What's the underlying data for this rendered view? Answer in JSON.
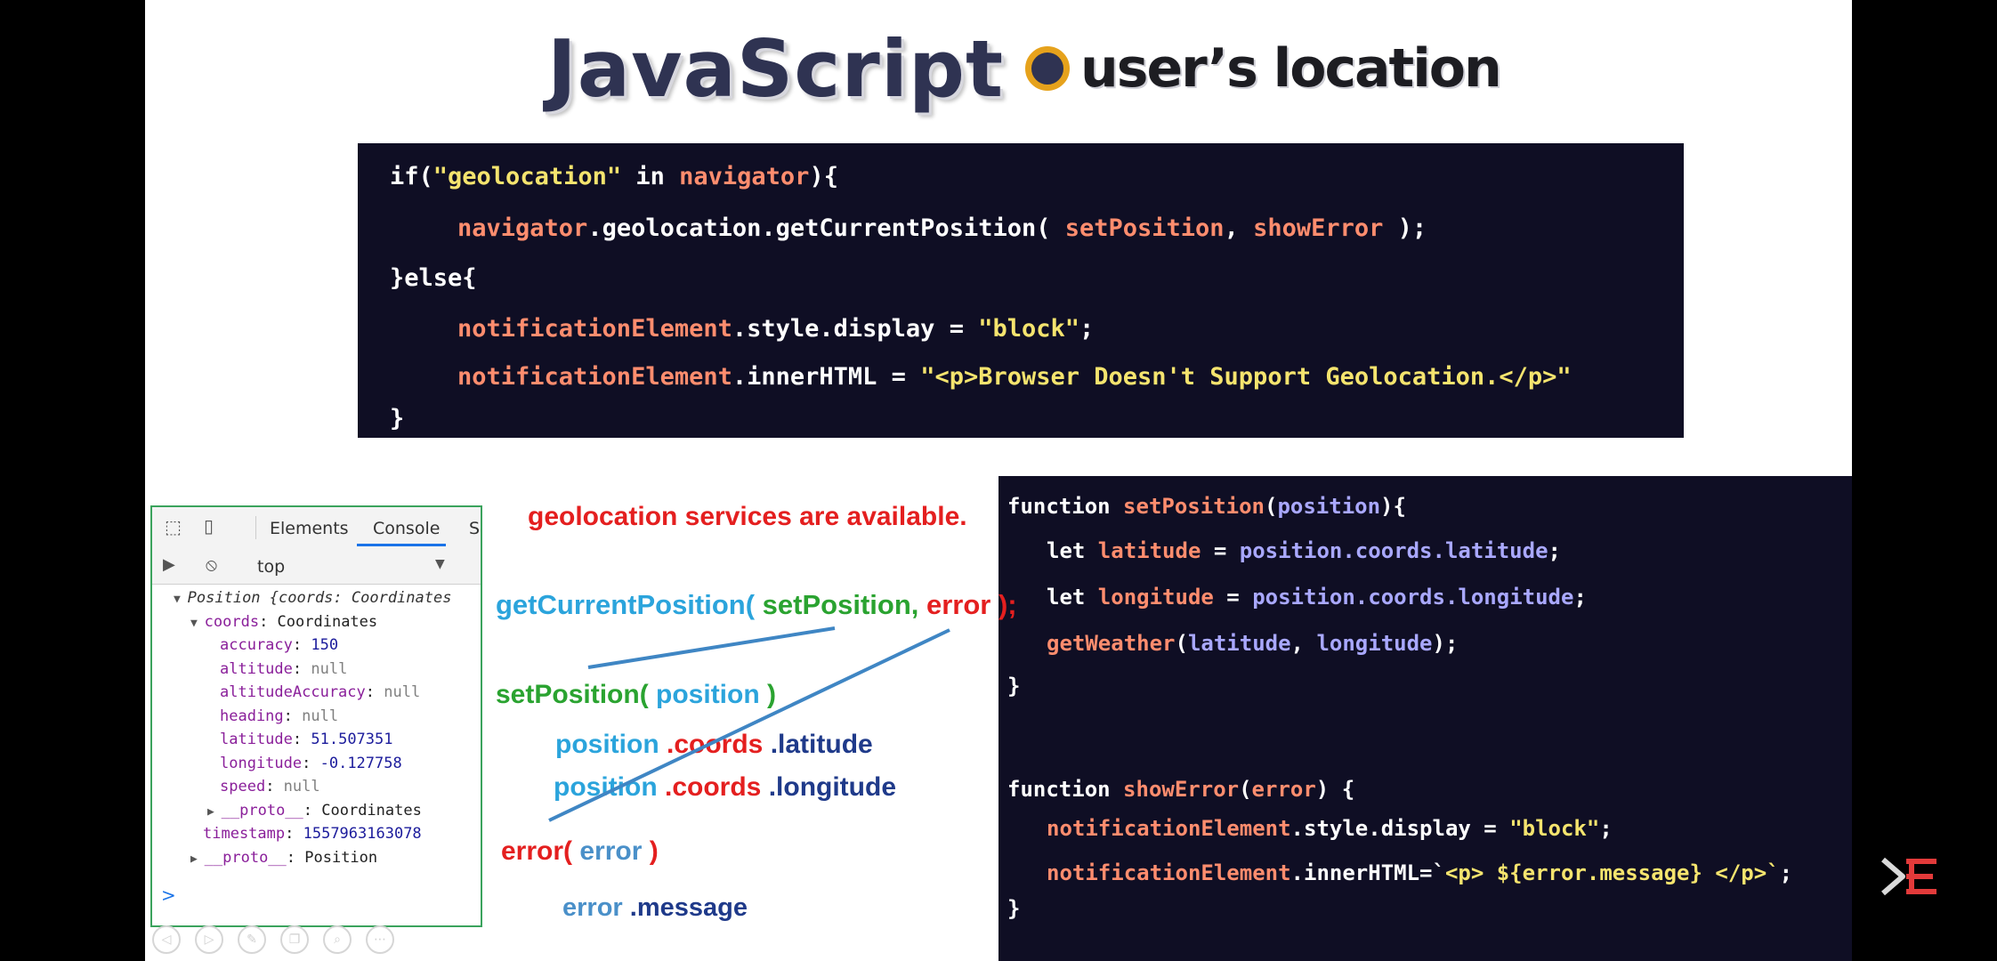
{
  "title": {
    "main": "JavaScript",
    "sub": "user’s location"
  },
  "code_block_1": {
    "lines": [
      [
        [
          "if(",
          "kw"
        ],
        [
          "\"geolocation\"",
          "str"
        ],
        [
          " in ",
          "kw"
        ],
        [
          "navigator",
          "obj"
        ],
        [
          "){",
          "kw"
        ]
      ],
      [
        [
          "navigator",
          "obj"
        ],
        [
          ".geolocation.getCurrentPosition( ",
          "kw"
        ],
        [
          "setPosition",
          "obj"
        ],
        [
          ", ",
          "kw"
        ],
        [
          "showError",
          "obj"
        ],
        [
          " );",
          "kw"
        ]
      ],
      [
        [
          "}else{",
          "kw"
        ]
      ],
      [
        [
          "notificationElement",
          "obj"
        ],
        [
          ".style.display = ",
          "kw"
        ],
        [
          "\"block\"",
          "str"
        ],
        [
          ";",
          "kw"
        ]
      ],
      [
        [
          "notificationElement",
          "obj"
        ],
        [
          ".innerHTML = ",
          "kw"
        ],
        [
          "\"<p>Browser Doesn't Support Geolocation.</p>\"",
          "str"
        ]
      ],
      [
        [
          "}",
          "kw"
        ]
      ]
    ]
  },
  "code_block_2": {
    "lines": [
      [
        [
          "function ",
          "kw"
        ],
        [
          "setPosition",
          "obj"
        ],
        [
          "(",
          "kw"
        ],
        [
          "position",
          "par"
        ],
        [
          "){",
          "kw"
        ]
      ],
      [
        [
          "let ",
          "kw"
        ],
        [
          "latitude",
          "obj"
        ],
        [
          " = ",
          "kw"
        ],
        [
          "position.coords.latitude",
          "par"
        ],
        [
          ";",
          "kw"
        ]
      ],
      [
        [
          "let ",
          "kw"
        ],
        [
          "longitude",
          "obj"
        ],
        [
          " = ",
          "kw"
        ],
        [
          "position.coords.longitude",
          "par"
        ],
        [
          ";",
          "kw"
        ]
      ],
      [
        [
          "getWeather",
          "obj"
        ],
        [
          "(",
          "kw"
        ],
        [
          "latitude",
          "par"
        ],
        [
          ", ",
          "kw"
        ],
        [
          "longitude",
          "par"
        ],
        [
          ");",
          "kw"
        ]
      ],
      [
        [
          "}",
          "kw"
        ]
      ],
      [
        [
          "function ",
          "kw"
        ],
        [
          "showError",
          "obj"
        ],
        [
          "(",
          "kw"
        ],
        [
          "error",
          "obj"
        ],
        [
          ") {",
          "kw"
        ]
      ],
      [
        [
          "notificationElement",
          "obj"
        ],
        [
          ".style.display = ",
          "kw"
        ],
        [
          "\"block\"",
          "str"
        ],
        [
          ";",
          "kw"
        ]
      ],
      [
        [
          "notificationElement",
          "obj"
        ],
        [
          ".innerHTML=`",
          "kw"
        ],
        [
          "<p> ${error.message} </p>`",
          "str"
        ],
        [
          ";",
          "kw"
        ]
      ],
      [
        [
          "}",
          "kw"
        ]
      ]
    ]
  },
  "devtools": {
    "tabs": [
      "Elements",
      "Console",
      "So"
    ],
    "active_tab": "Console",
    "context": "top",
    "tree": [
      {
        "indent": 0,
        "toggle": "▼",
        "parts": [
          [
            "Position {coords: Coordinates",
            "it"
          ]
        ]
      },
      {
        "indent": 1,
        "toggle": "▼",
        "parts": [
          [
            "coords",
            "k"
          ],
          [
            ": Coordinates",
            "v-obj"
          ]
        ]
      },
      {
        "indent": 2,
        "toggle": "",
        "parts": [
          [
            "accuracy",
            "k"
          ],
          [
            ": ",
            "v-obj"
          ],
          [
            "150",
            "v-num"
          ]
        ]
      },
      {
        "indent": 2,
        "toggle": "",
        "parts": [
          [
            "altitude",
            "k"
          ],
          [
            ": ",
            "v-obj"
          ],
          [
            "null",
            "v-null"
          ]
        ]
      },
      {
        "indent": 2,
        "toggle": "",
        "parts": [
          [
            "altitudeAccuracy",
            "k"
          ],
          [
            ": ",
            "v-obj"
          ],
          [
            "null",
            "v-null"
          ]
        ]
      },
      {
        "indent": 2,
        "toggle": "",
        "parts": [
          [
            "heading",
            "k"
          ],
          [
            ": ",
            "v-obj"
          ],
          [
            "null",
            "v-null"
          ]
        ]
      },
      {
        "indent": 2,
        "toggle": "",
        "parts": [
          [
            "latitude",
            "k"
          ],
          [
            ": ",
            "v-obj"
          ],
          [
            "51.507351",
            "v-num"
          ]
        ]
      },
      {
        "indent": 2,
        "toggle": "",
        "parts": [
          [
            "longitude",
            "k"
          ],
          [
            ": ",
            "v-obj"
          ],
          [
            "-0.127758",
            "v-num"
          ]
        ]
      },
      {
        "indent": 2,
        "toggle": "",
        "parts": [
          [
            "speed",
            "k"
          ],
          [
            ": ",
            "v-obj"
          ],
          [
            "null",
            "v-null"
          ]
        ]
      },
      {
        "indent": 2,
        "toggle": "▶",
        "parts": [
          [
            "__proto__",
            "k"
          ],
          [
            ": Coordinates",
            "v-obj"
          ]
        ]
      },
      {
        "indent": 1,
        "toggle": "",
        "parts": [
          [
            "timestamp",
            "k"
          ],
          [
            ": ",
            "v-obj"
          ],
          [
            "1557963163078",
            "v-num"
          ]
        ]
      },
      {
        "indent": 1,
        "toggle": "▶",
        "parts": [
          [
            "__proto__",
            "k"
          ],
          [
            ": Position",
            "v-obj"
          ]
        ]
      }
    ],
    "prompt": ">"
  },
  "annotations": {
    "available": "geolocation services are available.",
    "getcurrent": {
      "fn": "getCurrentPosition(",
      "arg1": " setPosition,",
      "arg2": " error ",
      "close": ");"
    },
    "setposition": {
      "fn": "setPosition(",
      "arg": " position ",
      "close": ")"
    },
    "lat": {
      "a": "position",
      "b": " .coords",
      "c": " .latitude"
    },
    "lon": {
      "a": "position",
      "b": " .coords",
      "c": " .longitude"
    },
    "errorfn": {
      "fn": "error(",
      "arg": " error ",
      "close": "  )"
    },
    "errmsg": {
      "a": "error",
      "b": " .message"
    }
  },
  "player_controls": [
    "prev-icon",
    "play-icon",
    "pen-icon",
    "copy-icon",
    "zoom-icon",
    "more-icon"
  ]
}
